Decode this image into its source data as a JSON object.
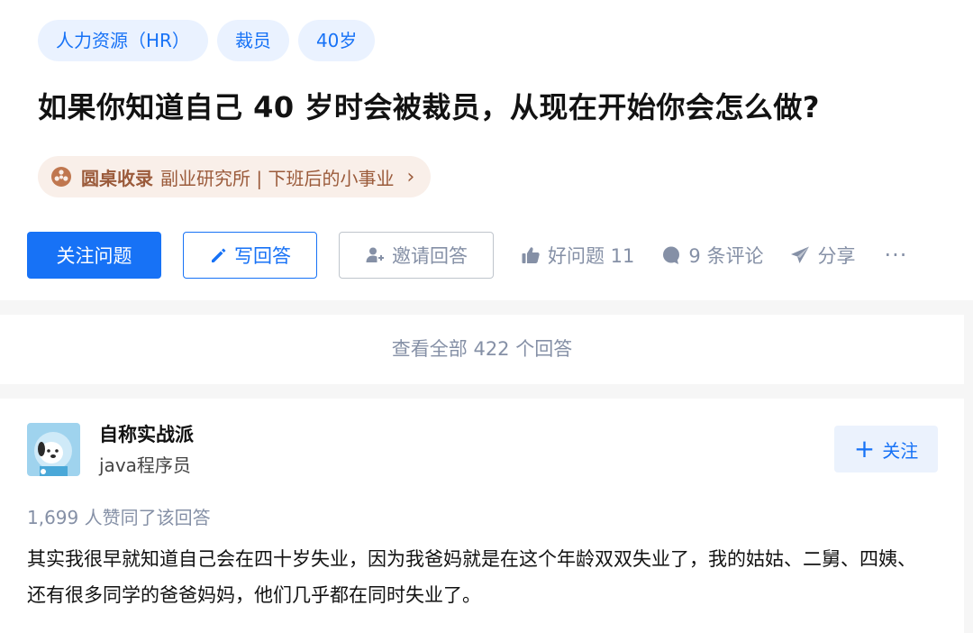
{
  "question": {
    "tags": [
      "人力资源（HR）",
      "裁员",
      "40岁"
    ],
    "title": "如果你知道自己 40 岁时会被裁员，从现在开始你会怎么做?",
    "roundtable": {
      "label": "圆桌收录",
      "name": "副业研究所 | 下班后的小事业",
      "accent": "#9b5b3b"
    },
    "actions": {
      "follow_label": "关注问题",
      "write_label": "写回答",
      "invite_label": "邀请回答",
      "good_question_label": "好问题 11",
      "comments_label": "9 条评论",
      "share_label": "分享",
      "more_label": "···"
    }
  },
  "view_all_label": "查看全部 422 个回答",
  "answer": {
    "author_name": "自称实战派",
    "author_bio": "java程序员",
    "follow_label": "关注",
    "vote_text": "1,699 人赞同了该回答",
    "content": "其实我很早就知道自己会在四十岁失业，因为我爸妈就是在这个年龄双双失业了，我的姑姑、二舅、四姨、还有很多同学的爸爸妈妈，他们几乎都在同时失业了。"
  },
  "colors": {
    "brand_blue": "#1772f6",
    "meta_gray": "#8590a6",
    "tag_bg": "#eaf2ff"
  }
}
